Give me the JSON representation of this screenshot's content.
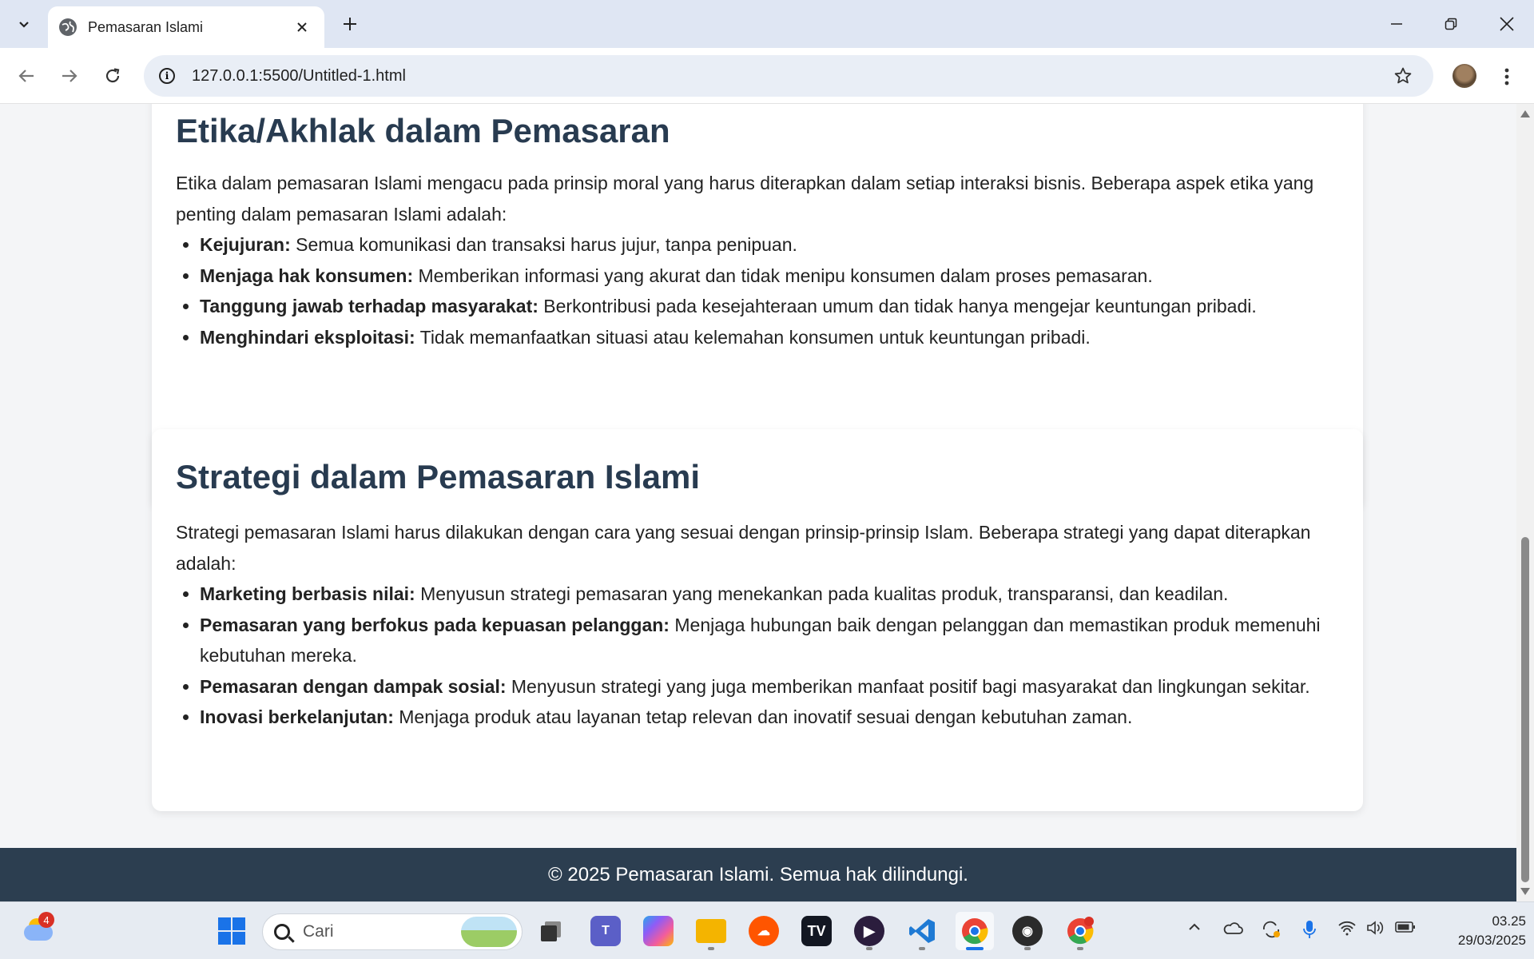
{
  "browser": {
    "tab_title": "Pemasaran Islami",
    "url": "127.0.0.1:5500/Untitled-1.html",
    "icons": {
      "tab_list": "chevron-down-icon",
      "close": "close-icon",
      "new_tab": "plus-icon",
      "back": "arrow-left-icon",
      "forward": "arrow-right-icon",
      "reload": "reload-icon",
      "site_info": "info-icon",
      "bookmark": "star-icon",
      "menu": "more-vertical-icon"
    }
  },
  "sections": [
    {
      "heading": "Etika/Akhlak dalam Pemasaran",
      "intro": "Etika dalam pemasaran Islami mengacu pada prinsip moral yang harus diterapkan dalam setiap interaksi bisnis. Beberapa aspek etika yang penting dalam pemasaran Islami adalah:",
      "items": [
        {
          "term": "Kejujuran:",
          "text": " Semua komunikasi dan transaksi harus jujur, tanpa penipuan."
        },
        {
          "term": "Menjaga hak konsumen:",
          "text": " Memberikan informasi yang akurat dan tidak menipu konsumen dalam proses pemasaran."
        },
        {
          "term": "Tanggung jawab terhadap masyarakat:",
          "text": " Berkontribusi pada kesejahteraan umum dan tidak hanya mengejar keuntungan pribadi."
        },
        {
          "term": "Menghindari eksploitasi:",
          "text": " Tidak memanfaatkan situasi atau kelemahan konsumen untuk keuntungan pribadi."
        }
      ]
    },
    {
      "heading": "Strategi dalam Pemasaran Islami",
      "intro": "Strategi pemasaran Islami harus dilakukan dengan cara yang sesuai dengan prinsip-prinsip Islam. Beberapa strategi yang dapat diterapkan adalah:",
      "items": [
        {
          "term": "Marketing berbasis nilai:",
          "text": " Menyusun strategi pemasaran yang menekankan pada kualitas produk, transparansi, dan keadilan."
        },
        {
          "term": "Pemasaran yang berfokus pada kepuasan pelanggan:",
          "text": " Menjaga hubungan baik dengan pelanggan dan memastikan produk memenuhi kebutuhan mereka."
        },
        {
          "term": "Pemasaran dengan dampak sosial:",
          "text": " Menyusun strategi yang juga memberikan manfaat positif bagi masyarakat dan lingkungan sekitar."
        },
        {
          "term": "Inovasi berkelanjutan:",
          "text": " Menjaga produk atau layanan tetap relevan dan inovatif sesuai dengan kebutuhan zaman."
        }
      ]
    }
  ],
  "footer": {
    "text": "© 2025 Pemasaran Islami. Semua hak dilindungi."
  },
  "taskbar": {
    "weather_badge": "4",
    "search_placeholder": "Cari",
    "apps": [
      {
        "name": "start-icon",
        "color": "#1a73e8"
      },
      {
        "name": "task-view-icon",
        "color": "#444444"
      },
      {
        "name": "teams-icon",
        "color": "#5b5fc7"
      },
      {
        "name": "copilot-icon",
        "color": "#8e5cf7"
      },
      {
        "name": "file-explorer-icon",
        "color": "#f4b400"
      },
      {
        "name": "soundcloud-icon",
        "color": "#ff5500"
      },
      {
        "name": "tradingview-icon",
        "color": "#131722"
      },
      {
        "name": "media-player-icon",
        "color": "#4a2c6e"
      },
      {
        "name": "vscode-icon",
        "color": "#1f7ad4"
      },
      {
        "name": "chrome-icon",
        "color": "#34a853"
      },
      {
        "name": "obs-icon",
        "color": "#2b2b2b"
      },
      {
        "name": "chrome-profile-icon",
        "color": "#ea4335"
      }
    ],
    "clock_time": "03.25",
    "clock_date": "29/03/2025"
  }
}
